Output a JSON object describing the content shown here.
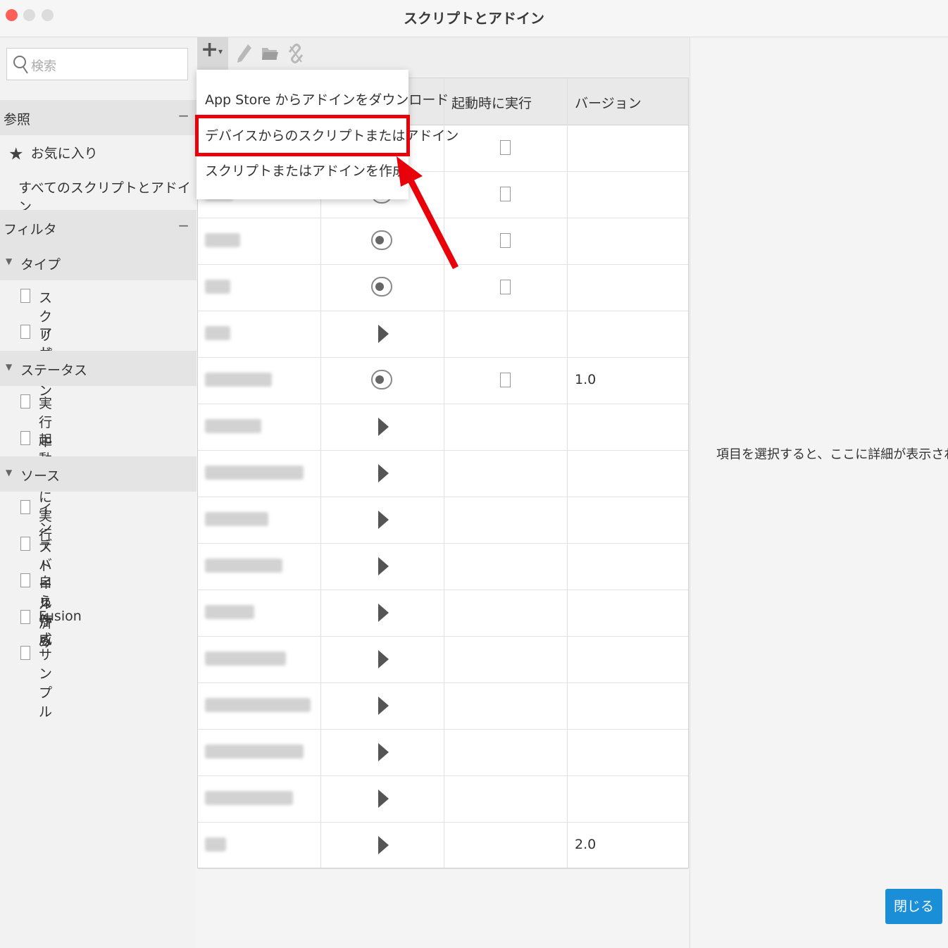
{
  "window": {
    "title": "スクリプトとアドイン"
  },
  "sidebar": {
    "search_placeholder": "検索",
    "reference": {
      "header": "参照",
      "collapse": "−",
      "items": [
        {
          "label": "お気に入り",
          "icon": "star-icon"
        },
        {
          "label": "すべてのスクリプトとアドイン"
        }
      ]
    },
    "filter": {
      "header": "フィルタ",
      "collapse": "−",
      "groups": [
        {
          "label": "タイプ",
          "items": [
            "スクリプト",
            "アドイン"
          ]
        },
        {
          "label": "ステータス",
          "items": [
            "実行中",
            "起動時に実行"
          ]
        },
        {
          "label": "ソース",
          "items": [
            "インストール済み",
            "デバイスから",
            "自ら作成",
            "Fusion",
            "サンプル"
          ]
        }
      ]
    }
  },
  "toolbar": {
    "add": "+",
    "add_caret": "▾"
  },
  "menu": {
    "items": [
      "App Store からアドインをダウンロード",
      "デバイスからのスクリプトまたはアドイン",
      "スクリプトまたはアドインを作成"
    ],
    "highlight_color": "#e8000b"
  },
  "table": {
    "columns": [
      "",
      "",
      "起動時に実行",
      "バージョン"
    ],
    "rows": [
      {
        "control": "none",
        "startup": true,
        "version": ""
      },
      {
        "control": "toggle",
        "startup": true,
        "version": ""
      },
      {
        "control": "toggle",
        "startup": true,
        "version": ""
      },
      {
        "control": "toggle",
        "startup": true,
        "version": ""
      },
      {
        "control": "play",
        "startup": false,
        "version": ""
      },
      {
        "control": "toggle",
        "startup": true,
        "version": "1.0"
      },
      {
        "control": "play",
        "startup": false,
        "version": ""
      },
      {
        "control": "play",
        "startup": false,
        "version": ""
      },
      {
        "control": "play",
        "startup": false,
        "version": ""
      },
      {
        "control": "play",
        "startup": false,
        "version": ""
      },
      {
        "control": "play",
        "startup": false,
        "version": ""
      },
      {
        "control": "play",
        "startup": false,
        "version": ""
      },
      {
        "control": "play",
        "startup": false,
        "version": ""
      },
      {
        "control": "play",
        "startup": false,
        "version": ""
      },
      {
        "control": "play",
        "startup": false,
        "version": ""
      },
      {
        "control": "play",
        "startup": false,
        "version": "2.0"
      }
    ]
  },
  "details": {
    "placeholder": "項目を選択すると、ここに詳細が表示されます"
  },
  "footer": {
    "close_label": "閉じる"
  },
  "colors": {
    "accent": "#1a8fd8",
    "annotation": "#e8000b"
  }
}
